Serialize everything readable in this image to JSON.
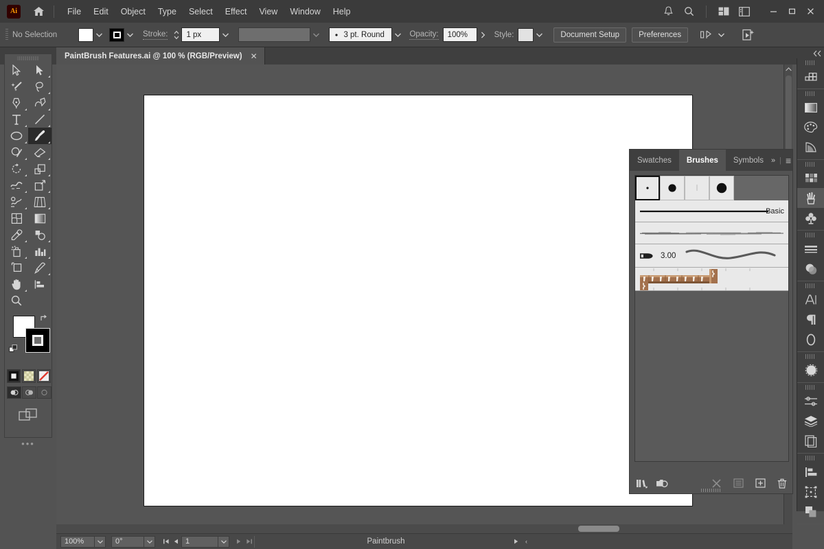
{
  "app": {
    "name": "Adobe Illustrator",
    "logo_text": "Ai",
    "colors": {
      "chrome": "#3b3b3b",
      "panel": "#535353",
      "canvas": "#555555",
      "accent_orange": "#ff9a00",
      "field_light": "#f0f0f0"
    }
  },
  "menubar": {
    "items": [
      {
        "label": "File"
      },
      {
        "label": "Edit"
      },
      {
        "label": "Object"
      },
      {
        "label": "Type"
      },
      {
        "label": "Select"
      },
      {
        "label": "Effect"
      },
      {
        "label": "View"
      },
      {
        "label": "Window"
      },
      {
        "label": "Help"
      }
    ],
    "right_icons": [
      {
        "name": "notifications-bell-icon"
      },
      {
        "name": "search-icon"
      },
      {
        "name": "arrange-documents-icon"
      },
      {
        "name": "workspace-switcher-icon"
      }
    ],
    "window_controls": [
      {
        "name": "minimize-button",
        "glyph": "—"
      },
      {
        "name": "maximize-button",
        "glyph": "□"
      },
      {
        "name": "close-button",
        "glyph": "✕"
      }
    ]
  },
  "controlbar": {
    "selection_status": "No Selection",
    "fill_label": "Fill",
    "stroke_label": "Stroke:",
    "stroke_weight": "1 px",
    "brush_definition": "3 pt. Round",
    "opacity_label": "Opacity:",
    "opacity_value": "100%",
    "style_label": "Style:",
    "document_setup_label": "Document Setup",
    "preferences_label": "Preferences",
    "variable_width_placeholder": ""
  },
  "tabbar": {
    "document_title": "PaintBrush Features.ai @ 100 % (RGB/Preview)",
    "close_glyph": "✕",
    "collapse_glyph": "«"
  },
  "toolbar": {
    "tools": [
      {
        "name": "selection-tool",
        "label": "Selection"
      },
      {
        "name": "direct-selection-tool",
        "label": "Direct Selection"
      },
      {
        "name": "magic-wand-tool",
        "label": "Magic Wand"
      },
      {
        "name": "lasso-tool",
        "label": "Lasso"
      },
      {
        "name": "pen-tool",
        "label": "Pen"
      },
      {
        "name": "curvature-tool",
        "label": "Curvature"
      },
      {
        "name": "type-tool",
        "label": "Type"
      },
      {
        "name": "line-segment-tool",
        "label": "Line Segment"
      },
      {
        "name": "ellipse-tool",
        "label": "Ellipse"
      },
      {
        "name": "paintbrush-tool",
        "label": "Paintbrush",
        "active": true
      },
      {
        "name": "shaper-tool",
        "label": "Shaper"
      },
      {
        "name": "eraser-tool",
        "label": "Eraser"
      },
      {
        "name": "rotate-tool",
        "label": "Rotate"
      },
      {
        "name": "scale-tool",
        "label": "Scale"
      },
      {
        "name": "width-tool",
        "label": "Width"
      },
      {
        "name": "free-transform-tool",
        "label": "Free Transform"
      },
      {
        "name": "shape-builder-tool",
        "label": "Shape Builder"
      },
      {
        "name": "perspective-grid-tool",
        "label": "Perspective Grid"
      },
      {
        "name": "mesh-tool",
        "label": "Mesh"
      },
      {
        "name": "gradient-tool",
        "label": "Gradient"
      },
      {
        "name": "eyedropper-tool",
        "label": "Eyedropper"
      },
      {
        "name": "blend-tool",
        "label": "Blend"
      },
      {
        "name": "symbol-sprayer-tool",
        "label": "Symbol Sprayer"
      },
      {
        "name": "column-graph-tool",
        "label": "Column Graph"
      },
      {
        "name": "artboard-tool",
        "label": "Artboard"
      },
      {
        "name": "slice-tool",
        "label": "Slice"
      },
      {
        "name": "hand-tool",
        "label": "Hand"
      },
      {
        "name": "zoom-tool",
        "label": "Zoom"
      }
    ],
    "fill_color": "#ffffff",
    "stroke_color": "#000000",
    "color_modes": [
      {
        "name": "color-mode-button",
        "selected": true
      },
      {
        "name": "gradient-mode-button",
        "selected": false
      },
      {
        "name": "none-mode-button",
        "selected": false
      }
    ],
    "draw_modes": [
      {
        "name": "draw-normal-button",
        "selected": true
      },
      {
        "name": "draw-behind-button",
        "selected": false
      },
      {
        "name": "draw-inside-button",
        "selected": false
      }
    ],
    "more_tools_glyph": "•••"
  },
  "panel": {
    "tabs": [
      {
        "name": "tab-swatches",
        "label": "Swatches",
        "active": false
      },
      {
        "name": "tab-brushes",
        "label": "Brushes",
        "active": true
      },
      {
        "name": "tab-symbols",
        "label": "Symbols",
        "active": false
      }
    ],
    "expand_glyph": "»",
    "menu_glyph": "≡",
    "presets": [
      {
        "name": "brush-preset-1-point-round",
        "selected": true,
        "dot": 3
      },
      {
        "name": "brush-preset-3-point-round",
        "selected": false,
        "dot": 11
      },
      {
        "name": "brush-preset-5-point-flat",
        "selected": false,
        "dot": 0
      },
      {
        "name": "brush-preset-10-point-oval",
        "selected": false,
        "dot": 14
      }
    ],
    "brushes": [
      {
        "name": "brush-basic",
        "label": "Basic",
        "kind": "stroke"
      },
      {
        "name": "brush-charcoal",
        "label": "",
        "kind": "charcoal"
      },
      {
        "name": "brush-width-3",
        "label": "3.00",
        "kind": "art"
      },
      {
        "name": "brush-pattern-rope",
        "label": "",
        "kind": "pattern"
      }
    ],
    "footer_icons": [
      {
        "name": "brush-libraries-menu-icon",
        "dim": false
      },
      {
        "name": "libraries-panel-icon",
        "dim": false
      },
      {
        "name": "remove-brush-stroke-icon",
        "dim": true
      },
      {
        "name": "brush-options-icon",
        "dim": true
      },
      {
        "name": "new-brush-icon",
        "dim": false
      },
      {
        "name": "delete-brush-icon",
        "dim": false
      }
    ]
  },
  "dock": {
    "groups": [
      {
        "icons": [
          {
            "name": "color-guide-icon",
            "active": false
          }
        ]
      },
      {
        "icons": [
          {
            "name": "gradient-icon",
            "active": false
          },
          {
            "name": "color-icon",
            "active": false
          },
          {
            "name": "color-themes-icon",
            "active": false
          }
        ]
      },
      {
        "icons": [
          {
            "name": "swatches-icon",
            "active": false
          },
          {
            "name": "brushes-icon",
            "active": true
          },
          {
            "name": "symbols-icon",
            "active": false
          }
        ]
      },
      {
        "icons": [
          {
            "name": "stroke-icon",
            "active": false
          },
          {
            "name": "transparency-icon",
            "active": false
          }
        ]
      },
      {
        "icons": [
          {
            "name": "character-icon",
            "active": false
          },
          {
            "name": "paragraph-icon",
            "active": false
          },
          {
            "name": "glyphs-icon",
            "active": false
          }
        ]
      },
      {
        "icons": [
          {
            "name": "appearance-icon",
            "active": false
          }
        ]
      },
      {
        "icons": [
          {
            "name": "properties-icon",
            "active": false
          },
          {
            "name": "layers-icon",
            "active": false
          },
          {
            "name": "artboards-icon",
            "active": false
          }
        ]
      },
      {
        "icons": [
          {
            "name": "align-icon",
            "active": false
          },
          {
            "name": "transform-icon",
            "active": false
          },
          {
            "name": "pathfinder-icon",
            "active": false
          }
        ]
      }
    ]
  },
  "statusbar": {
    "zoom_level": "100%",
    "rotation": "0°",
    "artboard_number": "1",
    "status_text": "Paintbrush",
    "first_glyph": "⏮",
    "prev_glyph": "◀",
    "next_glyph": "▶",
    "last_glyph": "⏭",
    "play_glyph": "▶",
    "resize_glyph": "‹"
  }
}
